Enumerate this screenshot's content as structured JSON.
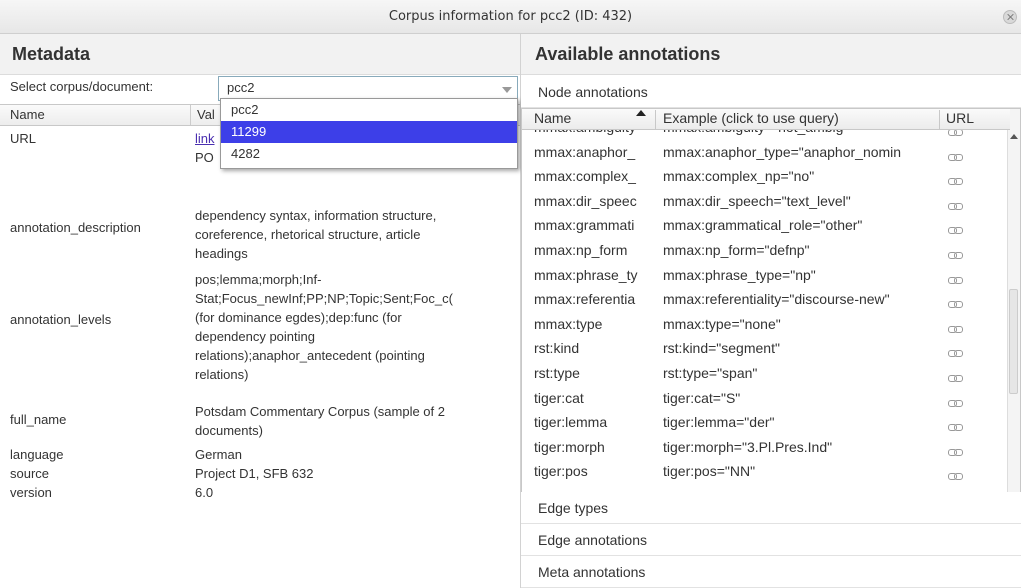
{
  "window": {
    "title": "Corpus information for pcc2 (ID: 432)"
  },
  "metadata": {
    "title": "Metadata",
    "select_label": "Select corpus/document:",
    "select_value": "pcc2",
    "dropdown_options": [
      "pcc2",
      "11299",
      "4282"
    ],
    "dropdown_selected_index": 1,
    "columns": [
      "Name",
      "Val"
    ],
    "rows": [
      {
        "key": "URL",
        "lines": [
          "link",
          "PO"
        ]
      },
      {
        "key": "annotation_description",
        "lines": [
          "dependency syntax, information structure,",
          "coreference, rhetorical structure, article",
          "headings"
        ]
      },
      {
        "key": "annotation_levels",
        "lines": [
          "pos;lemma;morph;Inf-",
          "Stat;Focus_newInf;PP;NP;Topic;Sent;Foc_c(",
          "(for dominance egdes);dep:func (for",
          "dependency pointing",
          "relations);anaphor_antecedent (pointing",
          "relations)"
        ]
      },
      {
        "key": "full_name",
        "lines": [
          "Potsdam Commentary Corpus (sample of 2",
          "documents)"
        ]
      },
      {
        "key": "language",
        "lines": [
          "German"
        ]
      },
      {
        "key": "source",
        "lines": [
          "Project D1, SFB 632"
        ]
      },
      {
        "key": "version",
        "lines": [
          "6.0"
        ]
      }
    ]
  },
  "annotations": {
    "title": "Available annotations",
    "sections": [
      "Node annotations",
      "Edge types",
      "Edge annotations",
      "Meta annotations"
    ],
    "columns": [
      "Name",
      "Example (click to use query)",
      "URL"
    ],
    "rows": [
      {
        "name": "mmax:ambiguity",
        "example": "mmax:ambiguity=\"not_ambig\""
      },
      {
        "name": "mmax:anaphor_",
        "example": "mmax:anaphor_type=\"anaphor_nomin"
      },
      {
        "name": "mmax:complex_",
        "example": "mmax:complex_np=\"no\""
      },
      {
        "name": "mmax:dir_speec",
        "example": "mmax:dir_speech=\"text_level\""
      },
      {
        "name": "mmax:grammati",
        "example": "mmax:grammatical_role=\"other\""
      },
      {
        "name": "mmax:np_form",
        "example": "mmax:np_form=\"defnp\""
      },
      {
        "name": "mmax:phrase_ty",
        "example": "mmax:phrase_type=\"np\""
      },
      {
        "name": "mmax:referentia",
        "example": "mmax:referentiality=\"discourse-new\""
      },
      {
        "name": "mmax:type",
        "example": "mmax:type=\"none\""
      },
      {
        "name": "rst:kind",
        "example": "rst:kind=\"segment\""
      },
      {
        "name": "rst:type",
        "example": "rst:type=\"span\""
      },
      {
        "name": "tiger:cat",
        "example": "tiger:cat=\"S\""
      },
      {
        "name": "tiger:lemma",
        "example": "tiger:lemma=\"der\""
      },
      {
        "name": "tiger:morph",
        "example": "tiger:morph=\"3.Pl.Pres.Ind\""
      },
      {
        "name": "tiger:pos",
        "example": "tiger:pos=\"NN\""
      }
    ],
    "url_icon": "link-icon"
  },
  "colors": {
    "selection": "#3d3fe8",
    "link": "#4a2fb0"
  }
}
